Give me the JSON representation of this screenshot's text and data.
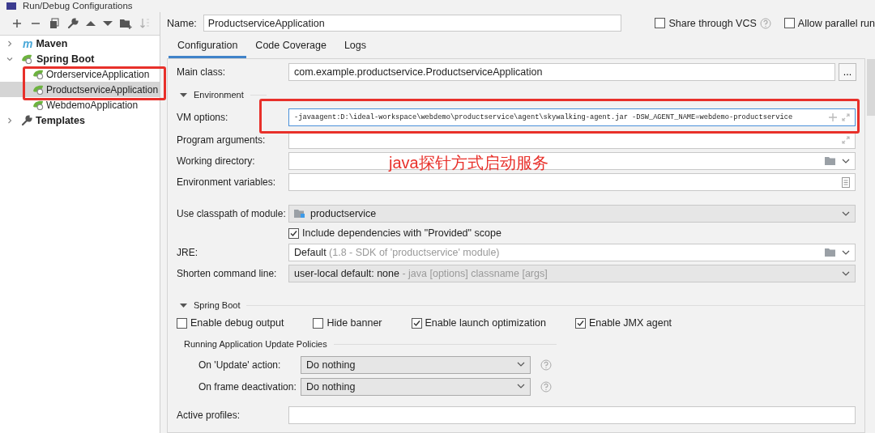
{
  "window": {
    "title": "Run/Debug Configurations"
  },
  "tree": [
    {
      "label": "Maven",
      "kind": "maven",
      "badge": "m",
      "expanded": false
    },
    {
      "label": "Spring Boot",
      "kind": "spring",
      "expanded": true,
      "children": [
        {
          "label": "OrderserviceApplication",
          "selected": false
        },
        {
          "label": "ProductserviceApplication",
          "selected": true
        },
        {
          "label": "WebdemoApplication",
          "selected": false
        }
      ]
    },
    {
      "label": "Templates",
      "kind": "templates",
      "expanded": false
    }
  ],
  "name": {
    "label": "Name:",
    "value": "ProductserviceApplication"
  },
  "options": [
    {
      "label": "Share through VCS",
      "checked": false,
      "help": true
    },
    {
      "label": "Allow parallel run",
      "checked": false,
      "help": false
    }
  ],
  "tabs": [
    {
      "label": "Configuration",
      "selected": true
    },
    {
      "label": "Code Coverage",
      "selected": false
    },
    {
      "label": "Logs",
      "selected": false
    }
  ],
  "main_class": {
    "label": "Main class:",
    "value": "com.example.productservice.ProductserviceApplication",
    "button": "..."
  },
  "environment": {
    "label": "Environment",
    "expanded": true
  },
  "env_fields": [
    {
      "label": "VM options:",
      "value": "-javaagent:D:\\ideal-workspace\\webdemo\\productservice\\agent\\skywalking-agent.jar -DSW_AGENT_NAME=webdemo-productservice",
      "kind": "vm"
    },
    {
      "label": "Program arguments:",
      "kind": "expand"
    },
    {
      "label": "Working directory:",
      "kind": "folder"
    },
    {
      "label": "Environment variables:",
      "kind": "doc"
    }
  ],
  "annotation": "java探针方式启动服务",
  "classpath": {
    "label": "Use classpath of module:",
    "value": "productservice"
  },
  "include_provided": {
    "label": "Include dependencies with \"Provided\" scope",
    "checked": true
  },
  "jre": {
    "label": "JRE:",
    "value": "Default",
    "hint": "(1.8 - SDK of 'productservice' module)"
  },
  "shorten": {
    "label": "Shorten command line:",
    "value": "user-local default: none",
    "hint": "- java [options] classname [args]"
  },
  "spring_boot": {
    "label": "Spring Boot",
    "expanded": true,
    "checks": [
      {
        "label": "Enable debug output",
        "checked": false
      },
      {
        "label": "Hide banner",
        "checked": false
      },
      {
        "label": "Enable launch optimization",
        "checked": true
      },
      {
        "label": "Enable JMX agent",
        "checked": true
      }
    ]
  },
  "policies": {
    "title": "Running Application Update Policies",
    "rows": [
      {
        "label": "On 'Update' action:",
        "value": "Do nothing"
      },
      {
        "label": "On frame deactivation:",
        "value": "Do nothing"
      }
    ]
  },
  "active_profiles": {
    "label": "Active profiles:"
  }
}
